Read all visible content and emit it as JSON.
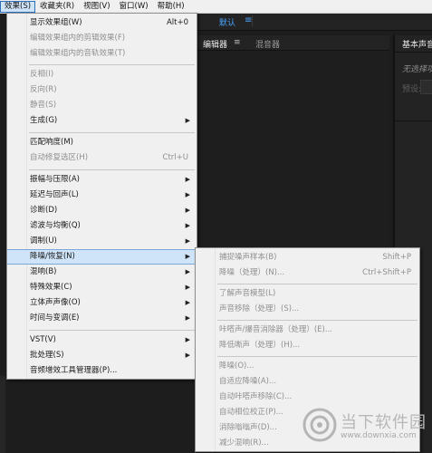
{
  "menubar": {
    "items": [
      {
        "label": "效果(S)",
        "active": true
      },
      {
        "label": "收藏夹(R)"
      },
      {
        "label": "视图(V)"
      },
      {
        "label": "窗口(W)"
      },
      {
        "label": "帮助(H)"
      }
    ]
  },
  "workspace": {
    "default_label": "默认",
    "menu_icon": "≡"
  },
  "editor_panel": {
    "tab_editor": "编辑器",
    "tab_editor_menu": "≡",
    "tab_mixer": "混音器"
  },
  "essential_panel": {
    "title": "基本声音",
    "note": "无选择项",
    "preset_label": "预设:"
  },
  "effects_menu": {
    "items": [
      {
        "label": "显示效果组(W)",
        "shortcut": "Alt+0",
        "disabled": false
      },
      {
        "label": "编辑效果组内的剪辑效果(F)",
        "disabled": true
      },
      {
        "label": "编辑效果组内的音轨效果(T)",
        "disabled": true
      },
      {
        "label": "反相(I)",
        "disabled": true
      },
      {
        "label": "反向(R)",
        "disabled": true
      },
      {
        "label": "静音(S)",
        "disabled": true
      },
      {
        "label": "生成(G)",
        "submenu": true
      },
      {
        "label": "匹配响度(M)"
      },
      {
        "label": "自动修复选区(H)",
        "shortcut": "Ctrl+U",
        "disabled": true
      },
      {
        "label": "振幅与压限(A)",
        "submenu": true
      },
      {
        "label": "延迟与回声(L)",
        "submenu": true
      },
      {
        "label": "诊断(D)",
        "submenu": true
      },
      {
        "label": "滤波与均衡(Q)",
        "submenu": true
      },
      {
        "label": "调制(U)",
        "submenu": true
      },
      {
        "label": "降噪/恢复(N)",
        "submenu": true,
        "highlight": true
      },
      {
        "label": "混响(B)",
        "submenu": true
      },
      {
        "label": "特殊效果(C)",
        "submenu": true
      },
      {
        "label": "立体声声像(O)",
        "submenu": true
      },
      {
        "label": "时间与变调(E)",
        "submenu": true
      },
      {
        "label": "VST(V)",
        "submenu": true
      },
      {
        "label": "批处理(S)",
        "submenu": true
      },
      {
        "label": "音频增效工具管理器(P)..."
      }
    ]
  },
  "noise_submenu": {
    "items": [
      {
        "label": "捕捉噪声样本(B)",
        "shortcut": "Shift+P"
      },
      {
        "label": "降噪（处理）(N)...",
        "shortcut": "Ctrl+Shift+P"
      },
      {
        "label": "了解声音模型(L)"
      },
      {
        "label": "声音移除（处理）(S)..."
      },
      {
        "label": "咔嗒声/爆音消除器（处理）(E)..."
      },
      {
        "label": "降低嘶声（处理）(H)..."
      },
      {
        "label": "降噪(O)..."
      },
      {
        "label": "自适应降噪(A)..."
      },
      {
        "label": "自动咔嗒声移除(C)..."
      },
      {
        "label": "自动相位校正(P)..."
      },
      {
        "label": "消除嗡嗡声(D)..."
      },
      {
        "label": "减少混响(R)..."
      }
    ]
  },
  "watermark": {
    "name": "当下软件园",
    "url": "www.downxia.com"
  }
}
